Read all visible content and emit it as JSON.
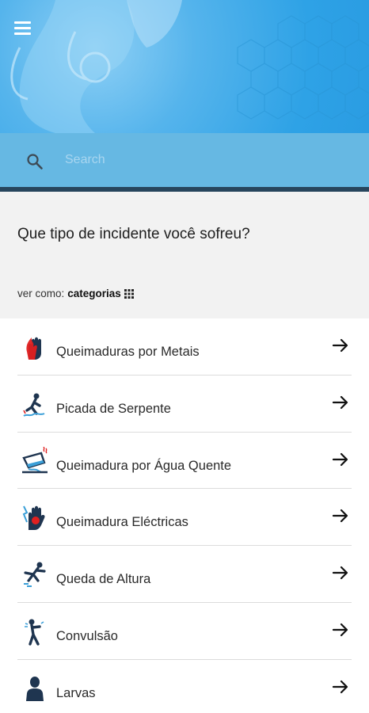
{
  "header": {
    "menu_icon": "hamburger-menu-icon",
    "background_color": "#2ea2e6"
  },
  "search": {
    "icon": "search-icon",
    "placeholder": "Search",
    "value": ""
  },
  "prompt": {
    "question": "Que tipo de incidente você sofreu?",
    "view_label": "ver como:",
    "view_value": "categorias",
    "view_icon": "grid-icon"
  },
  "incidents": [
    {
      "label": "Queimaduras por Metais",
      "icon": "burning-hand-icon"
    },
    {
      "label": "Picada de Serpente",
      "icon": "snake-bite-icon"
    },
    {
      "label": "Queimadura por Água Quente",
      "icon": "hot-water-icon"
    },
    {
      "label": "Queimadura Eléctricas",
      "icon": "electric-hand-icon"
    },
    {
      "label": "Queda de Altura",
      "icon": "falling-person-icon"
    },
    {
      "label": "Convulsão",
      "icon": "convulsion-icon"
    },
    {
      "label": "Larvas",
      "icon": "person-icon"
    }
  ],
  "colors": {
    "search_bar": "#66b8e3",
    "divider": "#27455d",
    "accent_red": "#e02020",
    "icon_navy": "#1f3550"
  }
}
